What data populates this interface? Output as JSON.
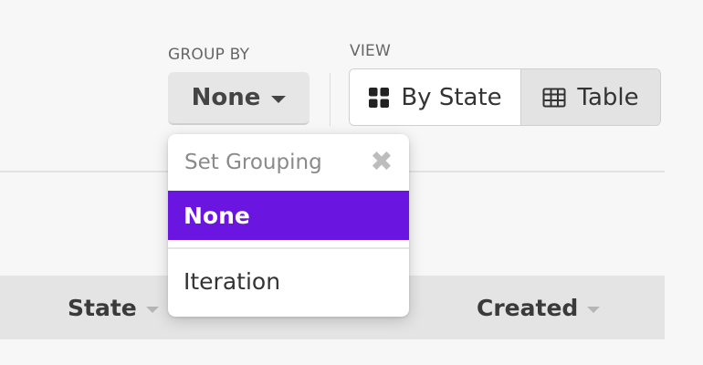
{
  "group_by": {
    "label": "GROUP BY",
    "value": "None"
  },
  "view": {
    "label": "VIEW",
    "options": [
      {
        "label": "By State",
        "icon": "grid-icon",
        "active": false
      },
      {
        "label": "Table",
        "icon": "table-icon",
        "active": true
      }
    ]
  },
  "table_header": {
    "columns": [
      "State",
      "Created"
    ]
  },
  "grouping_dropdown": {
    "title": "Set Grouping",
    "close_icon": "close-icon",
    "items": [
      {
        "label": "None",
        "selected": true
      },
      {
        "label": "Iteration",
        "selected": false
      }
    ]
  },
  "colors": {
    "accent": "#6b15e0"
  }
}
